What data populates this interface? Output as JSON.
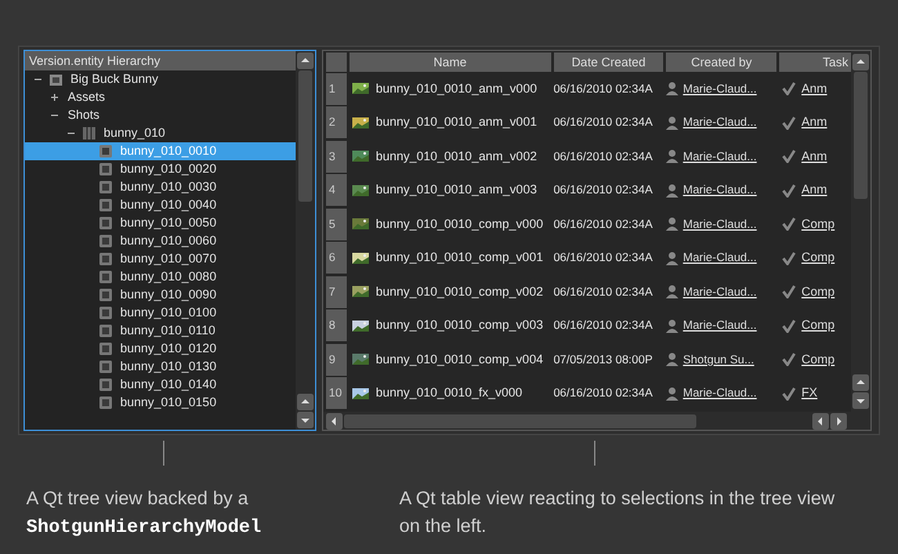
{
  "tree": {
    "title": "Version.entity Hierarchy",
    "items": [
      {
        "label": "Big Buck Bunny",
        "kind": "project",
        "expanded": true,
        "selected": false,
        "children": [
          {
            "label": "Assets",
            "kind": "folder",
            "expanded": false,
            "selected": false
          },
          {
            "label": "Shots",
            "kind": "folder",
            "expanded": true,
            "selected": false,
            "children": [
              {
                "label": "bunny_010",
                "kind": "sequence",
                "expanded": true,
                "selected": false,
                "children": [
                  {
                    "label": "bunny_010_0010",
                    "kind": "shot",
                    "selected": true
                  },
                  {
                    "label": "bunny_010_0020",
                    "kind": "shot",
                    "selected": false
                  },
                  {
                    "label": "bunny_010_0030",
                    "kind": "shot",
                    "selected": false
                  },
                  {
                    "label": "bunny_010_0040",
                    "kind": "shot",
                    "selected": false
                  },
                  {
                    "label": "bunny_010_0050",
                    "kind": "shot",
                    "selected": false
                  },
                  {
                    "label": "bunny_010_0060",
                    "kind": "shot",
                    "selected": false
                  },
                  {
                    "label": "bunny_010_0070",
                    "kind": "shot",
                    "selected": false
                  },
                  {
                    "label": "bunny_010_0080",
                    "kind": "shot",
                    "selected": false
                  },
                  {
                    "label": "bunny_010_0090",
                    "kind": "shot",
                    "selected": false
                  },
                  {
                    "label": "bunny_010_0100",
                    "kind": "shot",
                    "selected": false
                  },
                  {
                    "label": "bunny_010_0110",
                    "kind": "shot",
                    "selected": false
                  },
                  {
                    "label": "bunny_010_0120",
                    "kind": "shot",
                    "selected": false
                  },
                  {
                    "label": "bunny_010_0130",
                    "kind": "shot",
                    "selected": false
                  },
                  {
                    "label": "bunny_010_0140",
                    "kind": "shot",
                    "selected": false
                  },
                  {
                    "label": "bunny_010_0150",
                    "kind": "shot",
                    "selected": false
                  }
                ]
              }
            ]
          }
        ]
      }
    ]
  },
  "table": {
    "columns": [
      "Name",
      "Date Created",
      "Created by",
      "Task"
    ],
    "rows": [
      {
        "number": "1",
        "name": "bunny_010_0010_anm_v000",
        "date": "06/16/2010 02:34A",
        "created_by": "Marie-Claud...",
        "task": "Anm"
      },
      {
        "number": "2",
        "name": "bunny_010_0010_anm_v001",
        "date": "06/16/2010 02:34A",
        "created_by": "Marie-Claud...",
        "task": "Anm"
      },
      {
        "number": "3",
        "name": "bunny_010_0010_anm_v002",
        "date": "06/16/2010 02:34A",
        "created_by": "Marie-Claud...",
        "task": "Anm"
      },
      {
        "number": "4",
        "name": "bunny_010_0010_anm_v003",
        "date": "06/16/2010 02:34A",
        "created_by": "Marie-Claud...",
        "task": "Anm"
      },
      {
        "number": "5",
        "name": "bunny_010_0010_comp_v000",
        "date": "06/16/2010 02:34A",
        "created_by": "Marie-Claud...",
        "task": "Comp"
      },
      {
        "number": "6",
        "name": "bunny_010_0010_comp_v001",
        "date": "06/16/2010 02:34A",
        "created_by": "Marie-Claud...",
        "task": "Comp"
      },
      {
        "number": "7",
        "name": "bunny_010_0010_comp_v002",
        "date": "06/16/2010 02:34A",
        "created_by": "Marie-Claud...",
        "task": "Comp"
      },
      {
        "number": "8",
        "name": "bunny_010_0010_comp_v003",
        "date": "06/16/2010 02:34A",
        "created_by": "Marie-Claud...",
        "task": "Comp"
      },
      {
        "number": "9",
        "name": "bunny_010_0010_comp_v004",
        "date": "07/05/2013 08:00P",
        "created_by": "Shotgun Su...",
        "task": "Comp"
      },
      {
        "number": "10",
        "name": "bunny_010_0010_fx_v000",
        "date": "06/16/2010 02:34A",
        "created_by": "Marie-Claud...",
        "task": "FX"
      }
    ]
  },
  "captions": {
    "left": {
      "text": "A Qt tree view backed by a",
      "code": "ShotgunHierarchyModel"
    },
    "right": "A Qt table view reacting to selections in the tree view on the left."
  }
}
